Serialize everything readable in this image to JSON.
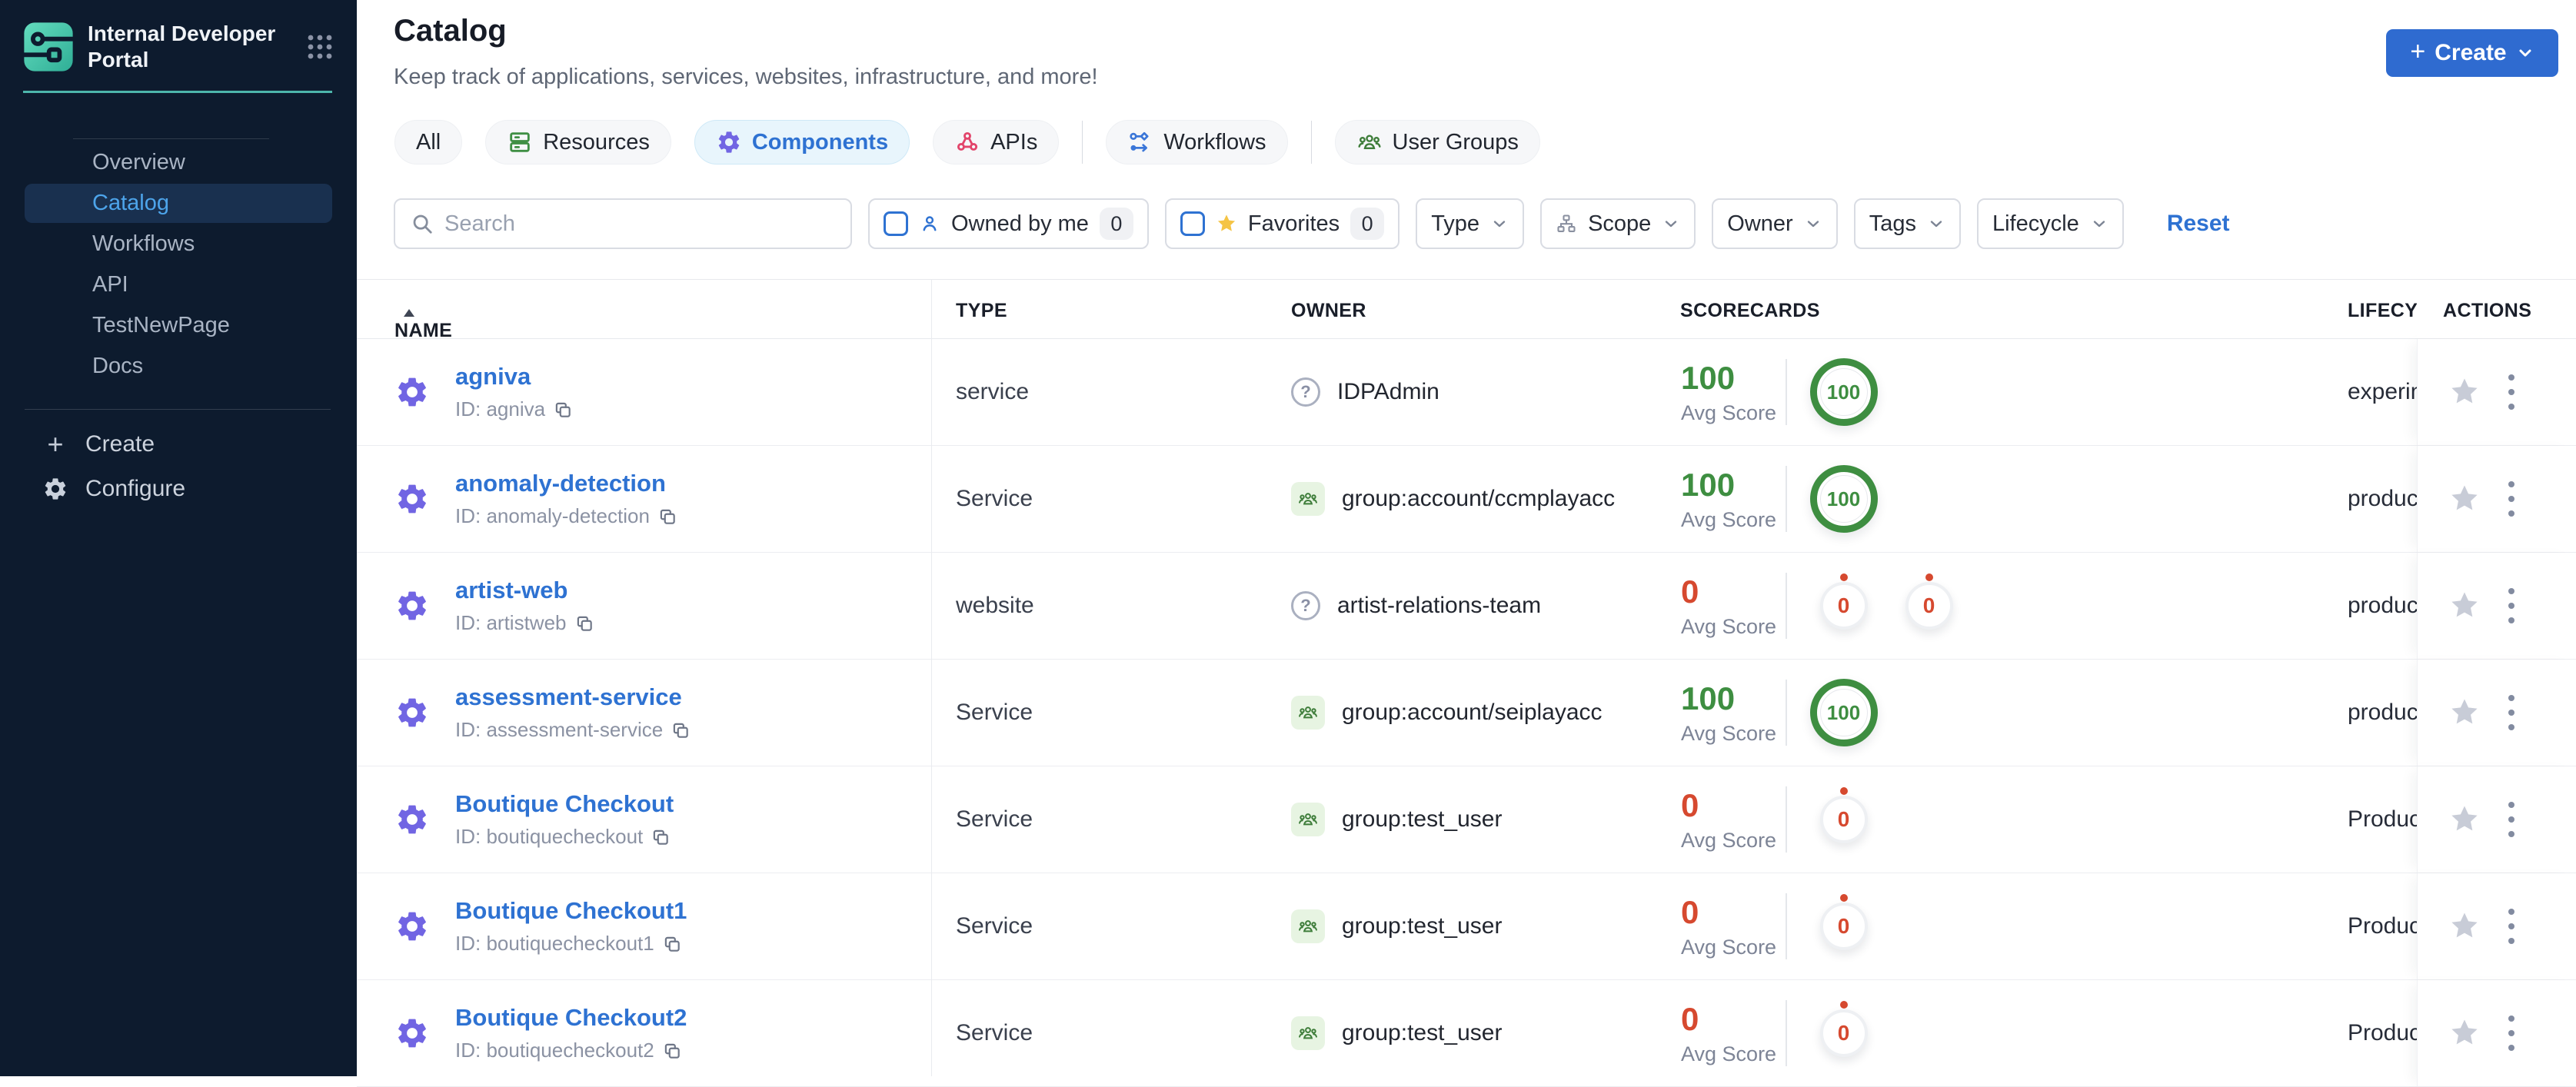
{
  "brand": {
    "name": "Internal Developer Portal"
  },
  "sidebar": {
    "items": [
      {
        "label": "Overview",
        "active": false
      },
      {
        "label": "Catalog",
        "active": true
      },
      {
        "label": "Workflows",
        "active": false
      },
      {
        "label": "API",
        "active": false
      },
      {
        "label": "TestNewPage",
        "active": false
      },
      {
        "label": "Docs",
        "active": false
      }
    ],
    "create_label": "Create",
    "configure_label": "Configure"
  },
  "header": {
    "title": "Catalog",
    "subtitle": "Keep track of applications, services, websites, infrastructure, and more!",
    "create_button": "Create"
  },
  "tabs": [
    {
      "label": "All"
    },
    {
      "label": "Resources",
      "icon": "resources-icon",
      "icon_color": "#3F8F44"
    },
    {
      "label": "Components",
      "icon": "components-icon",
      "icon_color": "#7165E3",
      "active": true
    },
    {
      "label": "APIs",
      "icon": "apis-icon",
      "icon_color": "#E2456B"
    },
    {
      "label": "Workflows",
      "icon": "workflows-icon",
      "icon_color": "#3B76D8",
      "divider_before": true
    },
    {
      "label": "User Groups",
      "icon": "user-groups-icon",
      "icon_color": "#3E7D3A",
      "divider_before": true
    }
  ],
  "filters": {
    "search_placeholder": "Search",
    "owned_by_me": {
      "label": "Owned by me",
      "count": "0"
    },
    "favorites": {
      "label": "Favorites",
      "count": "0"
    },
    "dropdowns": [
      {
        "label": "Type"
      },
      {
        "label": "Scope",
        "icon": "hierarchy-icon"
      },
      {
        "label": "Owner"
      },
      {
        "label": "Tags"
      },
      {
        "label": "Lifecycle"
      }
    ],
    "reset_label": "Reset"
  },
  "table": {
    "columns": [
      "NAME",
      "TYPE",
      "OWNER",
      "SCORECARDS",
      "LIFECYCLE",
      "ACTIONS"
    ],
    "avg_score_label": "Avg Score",
    "rows": [
      {
        "name": "agniva",
        "id": "ID: agniva",
        "type": "service",
        "owner": "IDPAdmin",
        "owner_icon": "help-circle-icon",
        "avg_score": "100",
        "scorecard_circles": [
          "100"
        ],
        "lifecycle": "experimental"
      },
      {
        "name": "anomaly-detection",
        "id": "ID: anomaly-detection",
        "type": "Service",
        "owner": "group:account/ccmplayacc",
        "owner_icon": "group-icon",
        "avg_score": "100",
        "scorecard_circles": [
          "100"
        ],
        "lifecycle": "production"
      },
      {
        "name": "artist-web",
        "id": "ID: artistweb",
        "type": "website",
        "owner": "artist-relations-team",
        "owner_icon": "help-circle-icon",
        "avg_score": "0",
        "scorecard_circles": [
          "0",
          "0"
        ],
        "lifecycle": "production"
      },
      {
        "name": "assessment-service",
        "id": "ID: assessment-service",
        "type": "Service",
        "owner": "group:account/seiplayacc",
        "owner_icon": "group-icon",
        "avg_score": "100",
        "scorecard_circles": [
          "100"
        ],
        "lifecycle": "production"
      },
      {
        "name": "Boutique Checkout",
        "id": "ID: boutiquecheckout",
        "type": "Service",
        "owner": "group:test_user",
        "owner_icon": "group-icon",
        "avg_score": "0",
        "scorecard_circles": [
          "0"
        ],
        "lifecycle": "Production"
      },
      {
        "name": "Boutique Checkout1",
        "id": "ID: boutiquecheckout1",
        "type": "Service",
        "owner": "group:test_user",
        "owner_icon": "group-icon",
        "avg_score": "0",
        "scorecard_circles": [
          "0"
        ],
        "lifecycle": "Production"
      },
      {
        "name": "Boutique Checkout2",
        "id": "ID: boutiquecheckout2",
        "type": "Service",
        "owner": "group:test_user",
        "owner_icon": "group-icon",
        "avg_score": "0",
        "scorecard_circles": [
          "0"
        ],
        "lifecycle": "Production"
      }
    ]
  },
  "colors": {
    "accent_blue": "#2E72D2",
    "success_green": "#3E8E41",
    "danger_red": "#D6492F",
    "sidebar_bg": "#0D1B2E",
    "teal_accent": "#4DB6AC",
    "star_gold": "#F5C445"
  }
}
